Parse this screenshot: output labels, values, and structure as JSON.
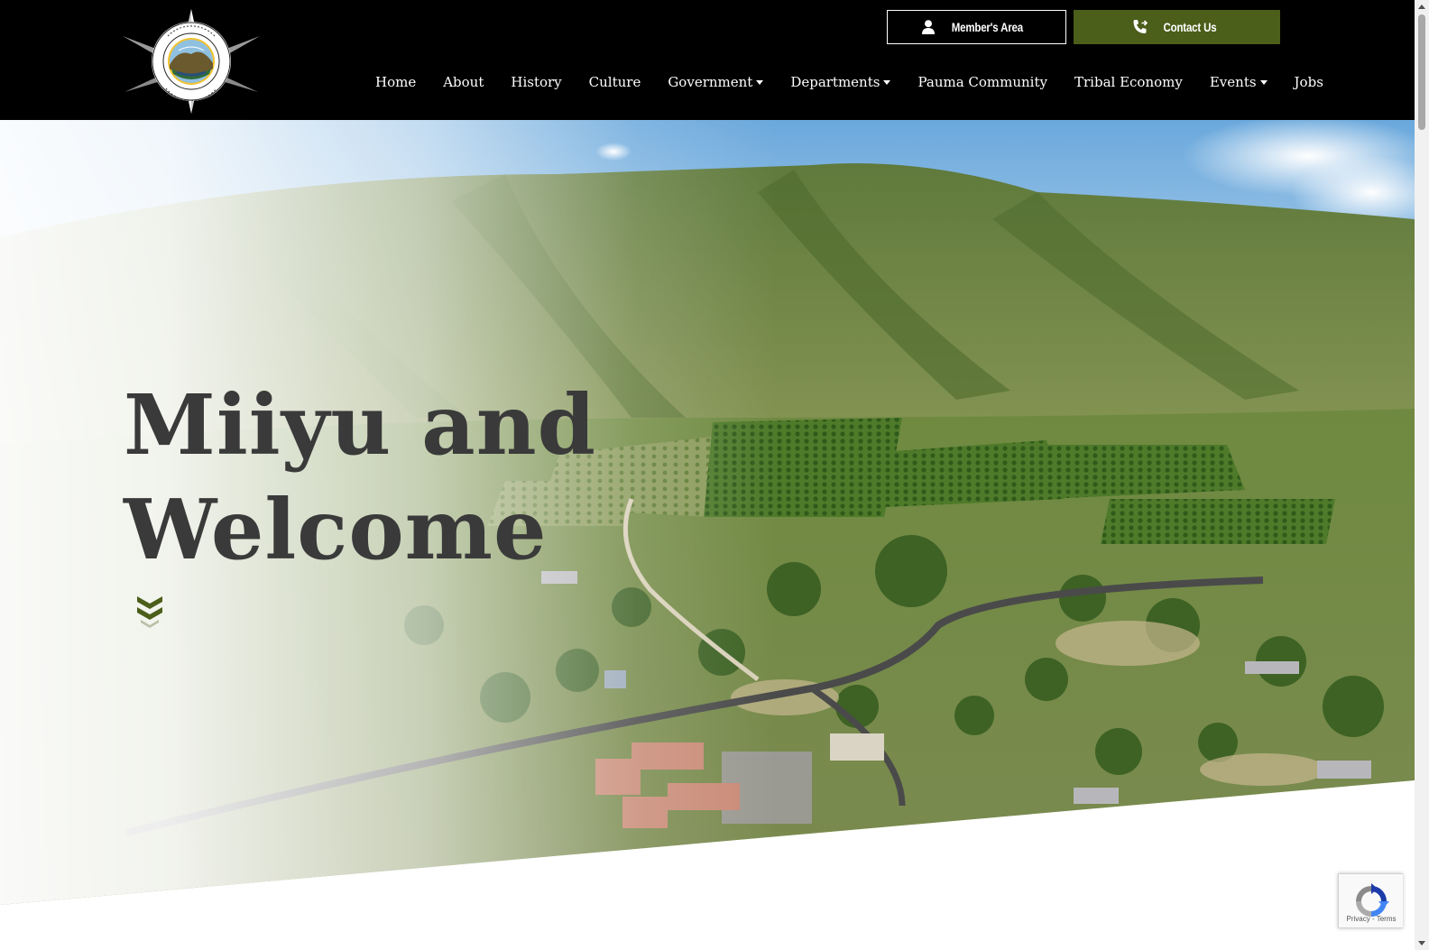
{
  "header": {
    "logo_alt": "Pauma / Yuima Band of Luiseño Indians",
    "member_button": "Member's Area",
    "contact_button": "Contact Us",
    "colors": {
      "background": "#000000",
      "contact_accent": "#4b5e1a",
      "nav_text": "#ffffff"
    }
  },
  "nav": [
    {
      "label": "Home",
      "dropdown": false
    },
    {
      "label": "About",
      "dropdown": false
    },
    {
      "label": "History",
      "dropdown": false
    },
    {
      "label": "Culture",
      "dropdown": false
    },
    {
      "label": "Government",
      "dropdown": true
    },
    {
      "label": "Departments",
      "dropdown": true
    },
    {
      "label": "Pauma Community",
      "dropdown": false
    },
    {
      "label": "Tribal Economy",
      "dropdown": false
    },
    {
      "label": "Events",
      "dropdown": true
    },
    {
      "label": "Jobs",
      "dropdown": false
    }
  ],
  "hero": {
    "title_line1": "Miiyu and",
    "title_line2": "Welcome",
    "scroll_icon": "double-chevron-down-icon",
    "colors": {
      "title": "#3a3a3a",
      "arrow": "#4b5e1a"
    }
  },
  "recaptcha": {
    "privacy": "Privacy",
    "separator": "-",
    "terms": "Terms"
  },
  "icons": {
    "member": "user-icon",
    "contact": "phone-forward-icon",
    "recaptcha": "recaptcha-icon"
  }
}
